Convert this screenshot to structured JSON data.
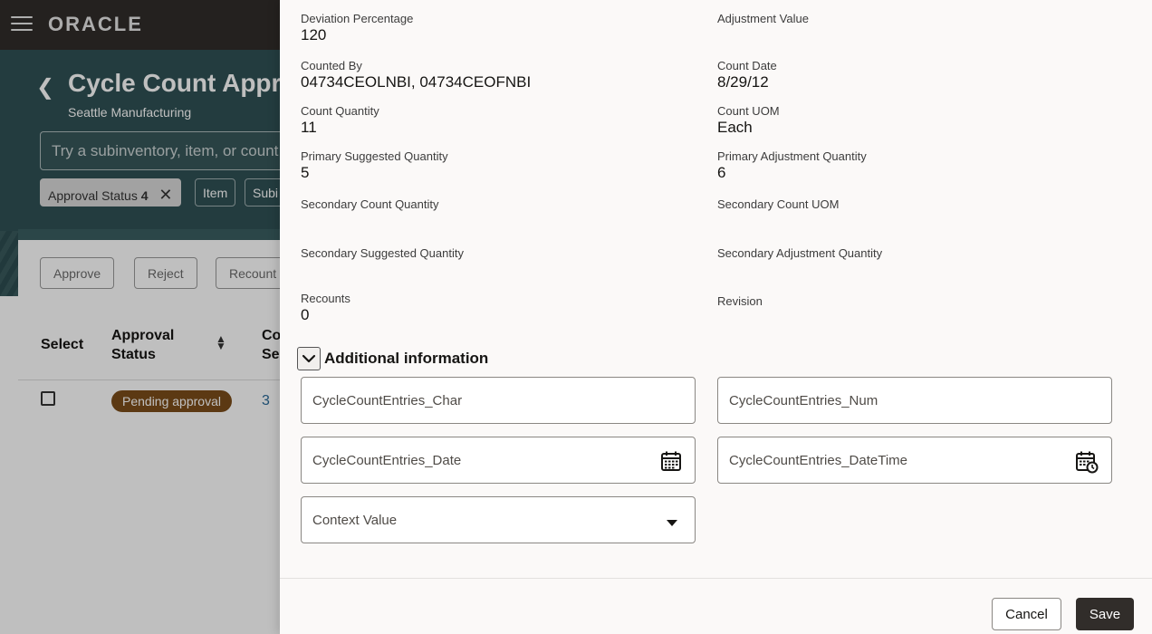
{
  "app": {
    "logo_text": "ORACLE",
    "title": "Cycle Count Appr",
    "subtitle": "Seattle Manufacturing"
  },
  "search": {
    "placeholder": "Try a subinventory, item, or count s"
  },
  "filters": [
    {
      "label": "Approval Status",
      "count": "4",
      "active": true
    },
    {
      "label": "Item"
    },
    {
      "label": "Subi"
    }
  ],
  "actions": {
    "approve": "Approve",
    "reject": "Reject",
    "recount": "Recount"
  },
  "table": {
    "headers": [
      "Select",
      "Approval Status",
      "Co Se"
    ],
    "rows": [
      {
        "status": "Pending approval",
        "sequence": "3"
      }
    ]
  },
  "drawer": {
    "fields_left": [
      {
        "label": "Deviation Percentage",
        "value": "120"
      },
      {
        "label": "Counted By",
        "value": "04734CEOLNBI, 04734CEOFNBI"
      },
      {
        "label": "Count Quantity",
        "value": "11"
      },
      {
        "label": "Primary Suggested Quantity",
        "value": "5"
      },
      {
        "label": "Secondary Count Quantity",
        "value": ""
      },
      {
        "label": "Secondary Suggested Quantity",
        "value": ""
      },
      {
        "label": "Recounts",
        "value": "0"
      }
    ],
    "fields_right": [
      {
        "label": "Adjustment Value",
        "value": ""
      },
      {
        "label": "Count Date",
        "value": "8/29/12"
      },
      {
        "label": "Count UOM",
        "value": "Each"
      },
      {
        "label": "Primary Adjustment Quantity",
        "value": "6"
      },
      {
        "label": "Secondary Count UOM",
        "value": ""
      },
      {
        "label": "Secondary Adjustment Quantity",
        "value": ""
      },
      {
        "label": "Revision",
        "value": ""
      }
    ],
    "section_title": "Additional information",
    "inputs": {
      "char": "CycleCountEntries_Char",
      "num": "CycleCountEntries_Num",
      "date": "CycleCountEntries_Date",
      "datetime": "CycleCountEntries_DateTime",
      "context": "Context Value"
    },
    "cancel_label": "Cancel",
    "save_label": "Save"
  },
  "colors": {
    "topbar": "#312d2a",
    "hero": "#2f5154",
    "badge": "#7b4d1a",
    "primary_button": "#312d2a",
    "link": "#2a6a98"
  }
}
